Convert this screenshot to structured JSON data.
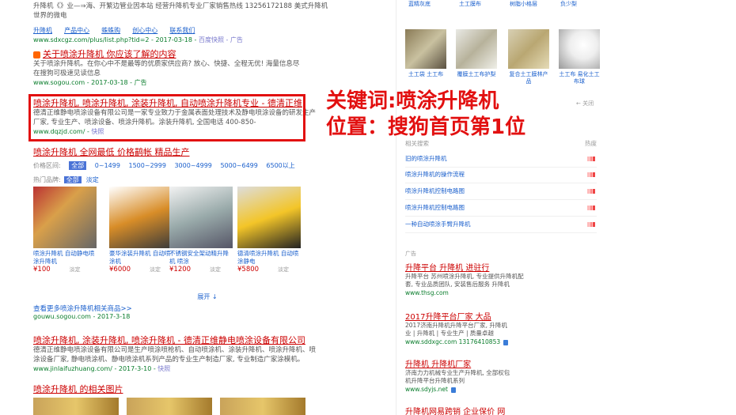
{
  "left": {
    "r1": {
      "desc": "升降机《》业—⇒海、开繁边管业因本站 经营升降机专业厂家销售热线 13256172188 美式升降机",
      "desc2": "世界的微电",
      "links": [
        "升降机",
        "产品中心",
        "蛛蛛购",
        "创心中心",
        "联系我们"
      ],
      "url": "www.sdxcgz.com/plus/list.php?tid=2 - 2017-03-18 - ",
      "snap": "百度快照 - 广告"
    },
    "r2": {
      "title": "关于喷涂升降机 你应该了解的内容",
      "desc": "关于喷涂升降机。在你心中不是最等的优质家供应商? 放心、快捷、全程无优! 海量信息尽",
      "desc2": "在搜狗可极速见读信息",
      "url": "www.sogou.com - 2017-03-18 - 广告"
    },
    "r3": {
      "title": "喷涂升降机, 喷涂升降机, 涂装升降机, 自动喷涂升降机专业 - 德清正维",
      "desc": "德清正维静电喷涂设备有限公司是一家专业致力于金属表面处理技术及静电喷涂设备的研发生产",
      "desc2": "厂家, 专业生产、喷涂设备、喷涂升降机。涂装升降机, 全国电话 400-850-",
      "url": "www.dqzjd.com/ - ",
      "snap": "快照"
    },
    "r4": {
      "title": "喷涂升降机 全网最低 价格鹋帐 精品生产",
      "price_label": "价格区间:",
      "price_sel": "全部",
      "price_opts": [
        "0~1499",
        "1500~2999",
        "3000~4999",
        "5000~6499",
        "6500以上"
      ],
      "hot_label": "热门品牌:",
      "hot_sel": "全部",
      "hot_opt": "淡定"
    },
    "products": [
      {
        "name": "喷涂升降机 自动静电喷涂升降机",
        "price": "¥100",
        "tag": "淡定"
      },
      {
        "name": "豪华涂装升降机 自动喷涂机",
        "price": "¥6000",
        "tag": "淡定"
      },
      {
        "name": "不锈钢安全架动精升降机 喷涂",
        "price": "¥1200",
        "tag": "淡定"
      },
      {
        "name": "德清喷涂升降机 自动喷涂静电",
        "price": "¥5800",
        "tag": "淡定"
      }
    ],
    "more_label": "展开 ↓",
    "gengduo": "查看更多喷涂升降机相关商品>>",
    "gengduo_url": "gouwu.sogou.com - 2017-3-18",
    "r5": {
      "title": "喷涂升降机, 涂装升降机, 喷涂升降机 - 德清正维静电喷涂设备有限公司",
      "desc": "德清正维静电喷涂设备有限公司是生产喷涂喷枪机、自动喷涂机、涂装升降机、喷涂升降机、喷",
      "desc2": "涂设备厂家, 静电喷涂机、静电喷涂机系列产品的专业生产制造厂家, 专业制造广家涂模机。",
      "url": "www.jinlaifuzhuang.com/ - 2017-3-10 - ",
      "snap": "快照"
    },
    "r6": {
      "title": "喷涂升降机 的相关图片"
    }
  },
  "annotation": {
    "line1": "关键词:喷涂升降机",
    "line2": "位置：搜狗首页第1位"
  },
  "right": {
    "toprow": [
      "蓝精灰底",
      "土工膜布",
      "树脂小格层",
      "负少梨"
    ],
    "images": [
      {
        "cap": "土工袋 土工布"
      },
      {
        "cap": "覆膜土工布护梨"
      },
      {
        "cap": "复合土工膜林产品"
      },
      {
        "cap": "土工布 易化土工布球"
      }
    ],
    "more": "← 关闭",
    "rel_head": "相关搜索",
    "rel_head_right": "热度",
    "related": [
      "旧的喷涂升降机",
      "喷涂升降机的操作流程",
      "喷涂升降机控制电路图",
      "喷涂升降机控制电路图",
      "一种自动喷涂手臂升降机"
    ],
    "ad_label": "广告",
    "ads": [
      {
        "title": "升降平台 升降机 进驻行",
        "d1": "升降平台 苏州喷涂升降机, 专业提供升降机配",
        "d2": "套, 专业品质团队, 安装售后服务 升降机",
        "url": "www.thsg.com"
      },
      {
        "title": "2017升降平台厂家 大品",
        "d1": "2017济南升降机升降平台厂家, 升降机",
        "d2": "业 | 升降机 | 专业生产 | 质量卓越",
        "url": "www.sddxgc.com 13176410853"
      },
      {
        "title": "升降机 升降机厂家",
        "d1": "济南力力机械专业生产升降机, 全部权包",
        "d2": "机升降平台升降机系列",
        "url": "www.sdyjs.net"
      },
      {
        "title": "升降机网易跨销 企业保价 网"
      }
    ]
  }
}
